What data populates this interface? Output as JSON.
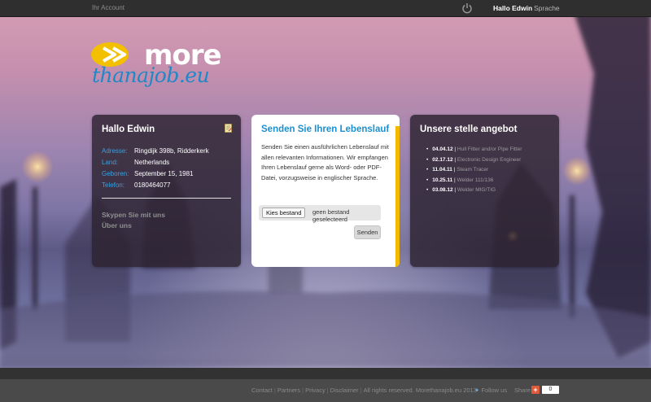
{
  "topbar": {
    "account": "Ihr Account",
    "hello": "Hallo Edwin",
    "language": "Sprache"
  },
  "logo": {
    "line1": "more",
    "line2": "thanajob.eu"
  },
  "profile_panel": {
    "title": "Hallo Edwin",
    "rows": [
      {
        "key": "Adresse:",
        "value": "Ringdijk 398b, Ridderkerk"
      },
      {
        "key": "Land:",
        "value": "Netherlands"
      },
      {
        "key": "Geboren:",
        "value": "September 15, 1981"
      },
      {
        "key": "Telefon:",
        "value": "0180464077"
      }
    ],
    "links": [
      "Skypen Sie mit uns",
      "Über uns"
    ]
  },
  "cv_panel": {
    "title": "Senden Sie Ihren Lebenslauf",
    "text": "Senden Sie einen ausführlichen Lebenslauf mit allen relevanten Informationen. Wir empfangen Ihren Lebenslauf gerne als Word- oder PDF-Datei, vorzugsweise in englischer Sprache.",
    "file_button": "Kies bestand",
    "file_status": "geen bestand geselecteerd",
    "send_button": "Senden"
  },
  "jobs_panel": {
    "title": "Unsere stelle angebot",
    "items": [
      {
        "date": "04.04.12",
        "title": "Hull Fitter and/or Pipe Fitter"
      },
      {
        "date": "02.17.12",
        "title": "Electronic Design Engineer"
      },
      {
        "date": "11.04.11",
        "title": "Steam Tracer"
      },
      {
        "date": "10.25.11",
        "title": "Welder 111/136"
      },
      {
        "date": "03.08.12",
        "title": "Welder MIG/TIG"
      }
    ]
  },
  "footer": {
    "links": [
      "Contact",
      "Partners",
      "Privacy",
      "Disclaimer"
    ],
    "copyright": "All rights reserved. Morethanajob.eu 2013",
    "follow": "Follow us",
    "share": "Share",
    "share_count": "0"
  },
  "colors": {
    "accent_blue": "#1e90d0",
    "accent_yellow": "#f3b800",
    "topbar": "#2f2f2f"
  }
}
